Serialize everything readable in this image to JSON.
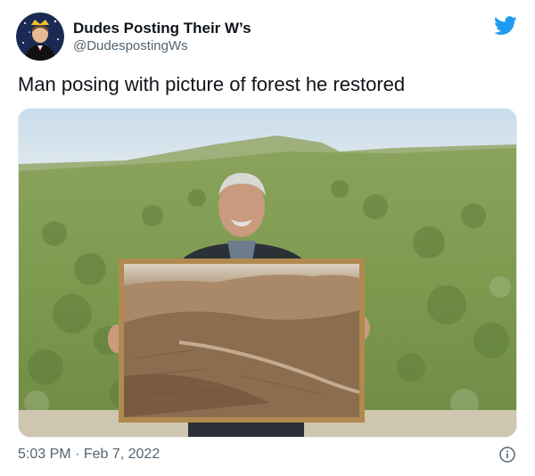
{
  "tweet": {
    "display_name": "Dudes Posting Their W’s",
    "handle": "@DudespostingWs",
    "text": "Man posing with picture of forest he restored",
    "time": "5:03 PM",
    "separator": "·",
    "date": "Feb 7, 2022"
  },
  "icons": {
    "brand": "twitter-bird-icon",
    "info": "info-icon",
    "avatar": "avatar"
  },
  "colors": {
    "twitter_blue": "#1d9bf0",
    "secondary_text": "#536471",
    "primary_text": "#0f1419"
  }
}
